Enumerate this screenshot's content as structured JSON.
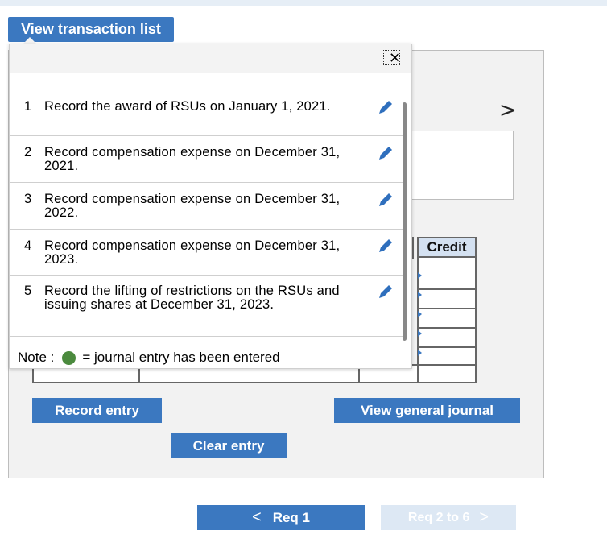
{
  "toolbar": {
    "view_transactions_label": "View transaction list",
    "record_entry_label": "Record entry",
    "clear_entry_label": "Clear entry",
    "view_general_journal_label": "View general journal"
  },
  "journal_table": {
    "credit_header": "Credit"
  },
  "nav": {
    "chevron": ">",
    "prev_label": "Req 1",
    "prev_arrow": "<",
    "next_label": "Req 2 to 6",
    "next_arrow": ">"
  },
  "popup": {
    "close_glyph": "✕",
    "items": [
      {
        "num": "1",
        "text": "Record the award of RSUs on January 1, 2021."
      },
      {
        "num": "2",
        "text": "Record compensation expense on December 31, 2021."
      },
      {
        "num": "3",
        "text": "Record compensation expense on December 31, 2022."
      },
      {
        "num": "4",
        "text": "Record compensation expense on December 31, 2023."
      },
      {
        "num": "5",
        "text": "Record the lifting of restrictions on the RSUs and issuing shares at December 31, 2023."
      }
    ],
    "note_label": "Note :",
    "note_text": "= journal entry has been entered"
  },
  "colors": {
    "button_blue": "#3b78c0",
    "disabled_button": "#dde8f4",
    "entered_dot": "#4b8a3e",
    "pencil": "#2f6fbd"
  }
}
